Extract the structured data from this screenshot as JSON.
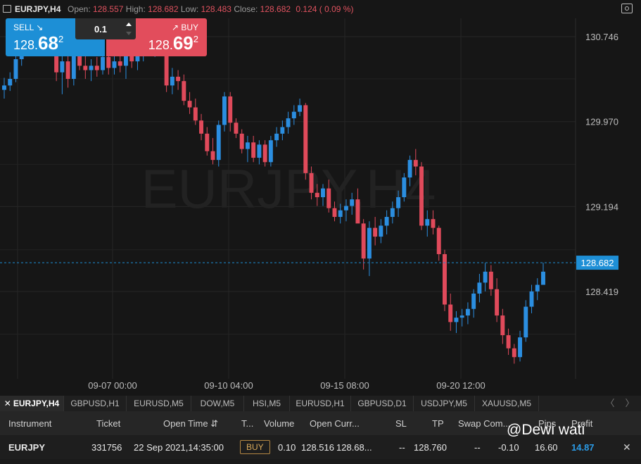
{
  "header": {
    "symbol": "EURJPY,H4",
    "open_label": "Open:",
    "open": "128.557",
    "high_label": "High:",
    "high": "128.682",
    "low_label": "Low:",
    "low": "128.483",
    "close_label": "Close:",
    "close": "128.682",
    "change": "0.124 ( 0.09 %)"
  },
  "icons": {
    "window": "window-icon",
    "screenshot": "camera-icon"
  },
  "trade": {
    "sell_label": "SELL ↘",
    "sell_price_small": "128.",
    "sell_price_big": "68",
    "sell_price_sup": "2",
    "buy_label": "↗ BUY",
    "buy_price_small": "128.",
    "buy_price_big": "69",
    "buy_price_sup": "2",
    "lot": "0.1"
  },
  "chart_data": {
    "type": "candlestick",
    "symbol": "EURJPY",
    "timeframe": "H4",
    "watermark": "EURJPY,H4",
    "y_ticks": [
      "130.746",
      "129.970",
      "129.194",
      "128.419"
    ],
    "x_ticks": [
      "09-07 00:00",
      "09-10 04:00",
      "09-15 08:00",
      "09-20 12:00"
    ],
    "current_price": "128.682",
    "ylim": [
      128.0,
      131.0
    ],
    "grid": true,
    "colors": {
      "up": "#2b8ee0",
      "down": "#e04a5b",
      "price_line": "#1e8fd6"
    },
    "candles": [
      [
        130.26,
        130.37,
        130.18,
        130.3
      ],
      [
        130.3,
        130.42,
        130.25,
        130.36
      ],
      [
        130.36,
        130.58,
        130.33,
        130.54
      ],
      [
        130.54,
        130.72,
        130.48,
        130.68
      ],
      [
        130.68,
        130.8,
        130.58,
        130.72
      ],
      [
        130.72,
        130.86,
        130.64,
        130.7
      ],
      [
        130.7,
        130.78,
        130.6,
        130.68
      ],
      [
        130.68,
        130.82,
        130.6,
        130.74
      ],
      [
        130.74,
        130.9,
        130.66,
        130.8
      ],
      [
        130.8,
        130.86,
        130.34,
        130.42
      ],
      [
        130.42,
        130.58,
        130.22,
        130.52
      ],
      [
        130.52,
        130.64,
        130.28,
        130.36
      ],
      [
        130.36,
        130.62,
        130.3,
        130.58
      ],
      [
        130.58,
        130.74,
        130.44,
        130.48
      ],
      [
        130.48,
        130.6,
        130.36,
        130.44
      ],
      [
        130.44,
        130.54,
        130.34,
        130.48
      ],
      [
        130.48,
        130.56,
        130.38,
        130.44
      ],
      [
        130.44,
        130.62,
        130.4,
        130.56
      ],
      [
        130.56,
        130.66,
        130.4,
        130.46
      ],
      [
        130.46,
        130.58,
        130.4,
        130.52
      ],
      [
        130.52,
        130.64,
        130.42,
        130.48
      ],
      [
        130.48,
        130.62,
        130.36,
        130.58
      ],
      [
        130.58,
        130.66,
        130.46,
        130.52
      ],
      [
        130.52,
        130.7,
        130.44,
        130.58
      ],
      [
        130.58,
        130.76,
        130.52,
        130.7
      ],
      [
        130.7,
        130.84,
        130.58,
        130.64
      ],
      [
        130.64,
        130.74,
        130.56,
        130.7
      ],
      [
        130.7,
        130.84,
        130.66,
        130.8
      ],
      [
        130.8,
        130.82,
        130.24,
        130.3
      ],
      [
        130.3,
        130.46,
        130.22,
        130.38
      ],
      [
        130.38,
        130.44,
        130.26,
        130.34
      ],
      [
        130.34,
        130.4,
        130.12,
        130.16
      ],
      [
        130.16,
        130.24,
        130.04,
        130.1
      ],
      [
        130.1,
        130.18,
        129.94,
        129.98
      ],
      [
        129.98,
        130.04,
        129.8,
        129.86
      ],
      [
        129.86,
        129.92,
        129.66,
        129.7
      ],
      [
        129.7,
        129.82,
        129.58,
        129.62
      ],
      [
        129.62,
        129.98,
        129.56,
        129.94
      ],
      [
        129.94,
        130.24,
        129.88,
        130.2
      ],
      [
        130.2,
        130.24,
        129.88,
        129.96
      ],
      [
        129.96,
        130.0,
        129.82,
        129.86
      ],
      [
        129.86,
        129.9,
        129.68,
        129.72
      ],
      [
        129.72,
        129.84,
        129.6,
        129.78
      ],
      [
        129.78,
        129.84,
        129.6,
        129.64
      ],
      [
        129.64,
        129.8,
        129.58,
        129.76
      ],
      [
        129.76,
        129.8,
        129.56,
        129.6
      ],
      [
        129.6,
        129.84,
        129.56,
        129.8
      ],
      [
        129.8,
        129.92,
        129.74,
        129.86
      ],
      [
        129.86,
        129.98,
        129.8,
        129.92
      ],
      [
        129.92,
        130.06,
        129.86,
        130.0
      ],
      [
        130.0,
        130.12,
        129.94,
        130.06
      ],
      [
        130.06,
        130.18,
        130.02,
        130.12
      ],
      [
        130.12,
        130.14,
        129.44,
        129.5
      ],
      [
        129.5,
        129.56,
        129.26,
        129.32
      ],
      [
        129.32,
        129.4,
        129.2,
        129.28
      ],
      [
        129.28,
        129.4,
        129.2,
        129.36
      ],
      [
        129.36,
        129.44,
        129.14,
        129.18
      ],
      [
        129.18,
        129.24,
        129.06,
        129.1
      ],
      [
        129.1,
        129.22,
        129.04,
        129.16
      ],
      [
        129.16,
        129.26,
        129.06,
        129.2
      ],
      [
        129.2,
        129.32,
        129.12,
        129.26
      ],
      [
        129.26,
        129.36,
        129.16,
        129.04
      ],
      [
        129.04,
        129.08,
        128.62,
        128.72
      ],
      [
        128.72,
        129.06,
        128.56,
        129.0
      ],
      [
        129.0,
        129.1,
        128.84,
        128.92
      ],
      [
        128.92,
        129.08,
        128.86,
        129.02
      ],
      [
        129.02,
        129.16,
        128.94,
        129.1
      ],
      [
        129.1,
        129.24,
        129.04,
        129.18
      ],
      [
        129.18,
        129.34,
        129.1,
        129.28
      ],
      [
        129.28,
        129.5,
        129.24,
        129.46
      ],
      [
        129.46,
        129.66,
        129.38,
        129.62
      ],
      [
        129.62,
        129.72,
        129.48,
        129.56
      ],
      [
        129.56,
        129.6,
        128.98,
        129.02
      ],
      [
        129.02,
        129.16,
        128.92,
        129.08
      ],
      [
        129.08,
        129.16,
        128.94,
        129.0
      ],
      [
        129.0,
        129.02,
        128.7,
        128.76
      ],
      [
        128.76,
        128.8,
        128.24,
        128.3
      ],
      [
        128.3,
        128.4,
        128.06,
        128.14
      ],
      [
        128.14,
        128.24,
        128.04,
        128.18
      ],
      [
        128.18,
        128.26,
        128.1,
        128.2
      ],
      [
        128.2,
        128.32,
        128.12,
        128.26
      ],
      [
        128.26,
        128.44,
        128.18,
        128.4
      ],
      [
        128.4,
        128.58,
        128.32,
        128.5
      ],
      [
        128.5,
        128.68,
        128.42,
        128.6
      ],
      [
        128.6,
        128.66,
        128.38,
        128.44
      ],
      [
        128.44,
        128.54,
        128.14,
        128.2
      ],
      [
        128.2,
        128.26,
        127.94,
        128.02
      ],
      [
        128.02,
        128.08,
        127.84,
        127.9
      ],
      [
        127.9,
        127.94,
        127.76,
        127.82
      ],
      [
        127.82,
        128.06,
        127.78,
        128.0
      ],
      [
        128.0,
        128.34,
        127.96,
        128.28
      ],
      [
        128.28,
        128.48,
        128.22,
        128.42
      ],
      [
        128.42,
        128.54,
        128.34,
        128.48
      ],
      [
        128.48,
        128.682,
        128.483,
        128.6
      ]
    ]
  },
  "tabs": [
    {
      "label": "EURJPY,H4",
      "close": "✕"
    },
    {
      "label": "GBPUSD,H1"
    },
    {
      "label": "EURUSD,M5"
    },
    {
      "label": "DOW,M5"
    },
    {
      "label": "HSI,M5"
    },
    {
      "label": "EURUSD,H1"
    },
    {
      "label": "GBPUSD,D1"
    },
    {
      "label": "USDJPY,M5"
    },
    {
      "label": "XAUUSD,M5"
    }
  ],
  "tab_nav": {
    "prev": "〈",
    "next": "〉"
  },
  "positions": {
    "columns": {
      "instrument": "Instrument",
      "ticket": "Ticket",
      "open_time": "Open Time ⇵",
      "type": "T...",
      "volume": "Volume",
      "open_curr": "Open Curr...",
      "sl": "SL",
      "tp": "TP",
      "swap": "Swap Com...",
      "pips": "Pips",
      "profit": "Profit"
    },
    "rows": [
      {
        "instrument": "EURJPY",
        "ticket": "331756",
        "open_time": "22 Sep 2021,14:35:00",
        "type": "BUY",
        "volume": "0.10",
        "open": "128.516",
        "current": "128.68...",
        "sl": "--",
        "tp": "128.760",
        "swap": "--",
        "commission": "-0.10",
        "pips": "16.60",
        "profit": "14.87",
        "close": "✕"
      }
    ]
  },
  "watermark_credit": "@Dewi wati"
}
